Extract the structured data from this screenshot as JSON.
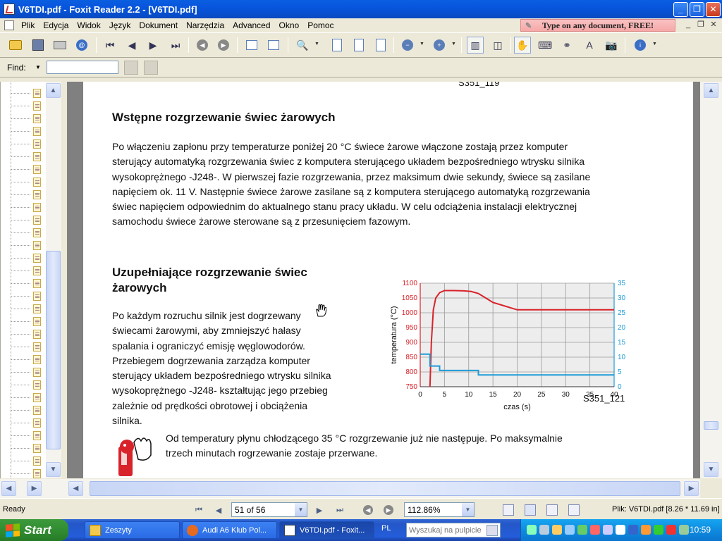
{
  "window": {
    "title": "V6TDI.pdf - Foxit Reader 2.2 - [V6TDI.pdf]"
  },
  "menu": {
    "items": [
      "Plik",
      "Edycja",
      "Widok",
      "Język",
      "Dokument",
      "Narzędzia",
      "Advanced",
      "Okno",
      "Pomoc"
    ]
  },
  "ad": {
    "text": "Type on any document, FREE!"
  },
  "find": {
    "label": "Find:",
    "value": ""
  },
  "document": {
    "top_label": "S351_119",
    "heading1": "Wstępne rozgrzewanie świec żarowych",
    "para1_lines": [
      "Po włączeniu zapłonu przy temperaturze poniżej 20 °C świece żarowe włączone zostają przez komputer",
      "sterujący automatyką rozgrzewania świec z komputera sterującego układem bezpośredniego wtrysku silnika",
      "wysokoprężnego -J248-. W pierwszej fazie rozgrzewania, przez maksimum dwie sekundy, świece są zasilane",
      "napięciem ok. 11 V. Następnie świece żarowe zasilane są z komputera sterującego automatyką rozgrzewania",
      "świec napięciem odpowiednim do aktualnego stanu pracy układu. W celu odciążenia instalacji elektrycznej",
      "samochodu świece żarowe sterowane są z przesunięciem fazowym."
    ],
    "heading2_lines": [
      "Uzupełniające rozgrzewanie świec",
      "żarowych"
    ],
    "para2_lines": [
      "Po każdym rozruchu silnik jest dogrzewany",
      "świecami żarowymi, aby zmniejszyć hałasy",
      "spalania i ograniczyć emisję węglowodorów.",
      "Przebiegem dogrzewania zarządza komputer",
      "sterujący układem bezpośredniego wtrysku silnika",
      "wysokoprężnego -J248- kształtując jego przebieg",
      "zależnie od prędkości obrotowej i obciążenia",
      "silnika."
    ],
    "note_lines": [
      "Od temperatury płynu chłodzącego 35 °C rozgrzewanie już nie następuje. Po maksymalnie",
      "trzech minutach rogrzewanie zostaje przerwane."
    ],
    "figure_label": "S351_121"
  },
  "chart_data": {
    "type": "line",
    "xlabel": "czas (s)",
    "ylabel_left": "temperatura (°C)",
    "ylabel_right": "napięcie (V)",
    "xlim": [
      0,
      40
    ],
    "ylim_left": [
      750,
      1100
    ],
    "ylim_right": [
      0,
      35
    ],
    "x_ticks": [
      0,
      5,
      10,
      15,
      20,
      25,
      30,
      35,
      40
    ],
    "y_ticks_left": [
      750,
      800,
      850,
      900,
      950,
      1000,
      1050,
      1100
    ],
    "y_ticks_right": [
      0,
      5,
      10,
      15,
      20,
      25,
      30,
      35
    ],
    "grid": true,
    "series": [
      {
        "axis": "left",
        "color": "#D8232A",
        "x": [
          2,
          2.3,
          2.7,
          3.2,
          4,
          5,
          7,
          9,
          10.5,
          12,
          13,
          14,
          15,
          17,
          19,
          20,
          25,
          30,
          35,
          40
        ],
        "y": [
          750,
          900,
          1010,
          1050,
          1068,
          1075,
          1075,
          1074,
          1072,
          1065,
          1055,
          1045,
          1035,
          1025,
          1015,
          1010,
          1010,
          1010,
          1010,
          1010
        ]
      },
      {
        "axis": "right",
        "color": "#1E9BD7",
        "x": [
          0,
          2,
          2,
          4,
          4,
          12,
          12,
          40
        ],
        "y": [
          11,
          11,
          7,
          7,
          5.5,
          5.5,
          4,
          4
        ]
      }
    ]
  },
  "status": {
    "ready": "Ready",
    "page_display": "51 of 56",
    "zoom_display": "112.86%",
    "file_info": "Plik: V6TDI.pdf [8.26 * 11.69 in]"
  },
  "taskbar": {
    "start_label": "Start",
    "tasks": [
      "Zeszyty",
      "Audi A6 Klub Pol...",
      "V6TDI.pdf - Foxit..."
    ],
    "lang": "PL",
    "search_placeholder": "Wyszukaj na pulpicie",
    "clock": "10:59"
  }
}
